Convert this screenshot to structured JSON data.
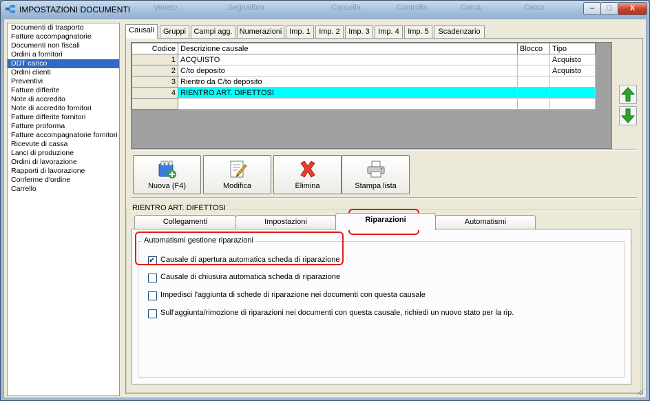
{
  "window": {
    "title": "IMPOSTAZIONI DOCUMENTI",
    "minimize": "–",
    "maximize": "□",
    "close": "X"
  },
  "background_taskbar": {
    "items": [
      "Veneto",
      "Segnalibro",
      "Cancella",
      "Controlla",
      "Cerca",
      "Cerca"
    ]
  },
  "sidebar": {
    "items": [
      "Documenti di trasporto",
      "Fatture accompagnatorie",
      "Documenti non fiscali",
      "Ordini a fornitori",
      "DDT carico",
      "Ordini clienti",
      "Preventivi",
      "Fatture differite",
      "Note di accredito",
      "Note di accredito fornitori",
      "Fatture differite fornitori",
      "Fatture proforma",
      "Fatture accompagnatorie fornitori",
      "Ricevute di cassa",
      "Lanci di produzione",
      "Ordini di lavorazione",
      "Rapporti di lavorazione",
      "Conferme d'ordine",
      "Carrello"
    ],
    "selected_index": 4
  },
  "tabs": [
    "Causali",
    "Gruppi",
    "Campi agg.",
    "Numerazioni",
    "Imp. 1",
    "Imp. 2",
    "Imp. 3",
    "Imp. 4",
    "Imp. 5",
    "Scadenzario"
  ],
  "active_tab": "Causali",
  "grid": {
    "headers": [
      "Codice",
      "Descrizione causale",
      "Blocco",
      "Tipo"
    ],
    "rows": [
      {
        "codice": "1",
        "descrizione": "ACQUISTO",
        "blocco": "",
        "tipo": "Acquisto"
      },
      {
        "codice": "2",
        "descrizione": "C/to deposito",
        "blocco": "",
        "tipo": "Acquisto"
      },
      {
        "codice": "3",
        "descrizione": "Rientro da C/to deposito",
        "blocco": "",
        "tipo": ""
      },
      {
        "codice": "4",
        "descrizione": "RIENTRO ART. DIFETTOSI",
        "blocco": "",
        "tipo": ""
      },
      {
        "codice": "",
        "descrizione": "",
        "blocco": "",
        "tipo": ""
      }
    ],
    "highlight_color": "#00ffff"
  },
  "toolbar": {
    "nuova": "Nuova (F4)",
    "modifica": "Modifica",
    "elimina": "Elimina",
    "stampa": "Stampa lista"
  },
  "detail": {
    "group_title": "RIENTRO ART. DIFETTOSI",
    "subtabs": [
      "Collegamenti",
      "Impostazioni",
      "Riparazioni",
      "Automatismi"
    ],
    "active_subtab": "Riparazioni",
    "section_title": "Automatismi gestione riparazioni",
    "options": [
      {
        "label": "Causale di apertura automatica scheda di riparazione",
        "checked": true
      },
      {
        "label": "Causale di chiusura automatica scheda di riparazione",
        "checked": false
      },
      {
        "label": "Impedisci l'aggiunta di schede di riparazione nei documenti con questa causale",
        "checked": false
      },
      {
        "label": "Sull'aggiunta/rimozione di riparazioni nei documenti con questa causale, richiedi un nuovo stato per la rip.",
        "checked": false
      }
    ]
  },
  "colors": {
    "accent_red": "#e31b1b",
    "selection_blue": "#316ac5",
    "arrow_green": "#2fa52f"
  }
}
